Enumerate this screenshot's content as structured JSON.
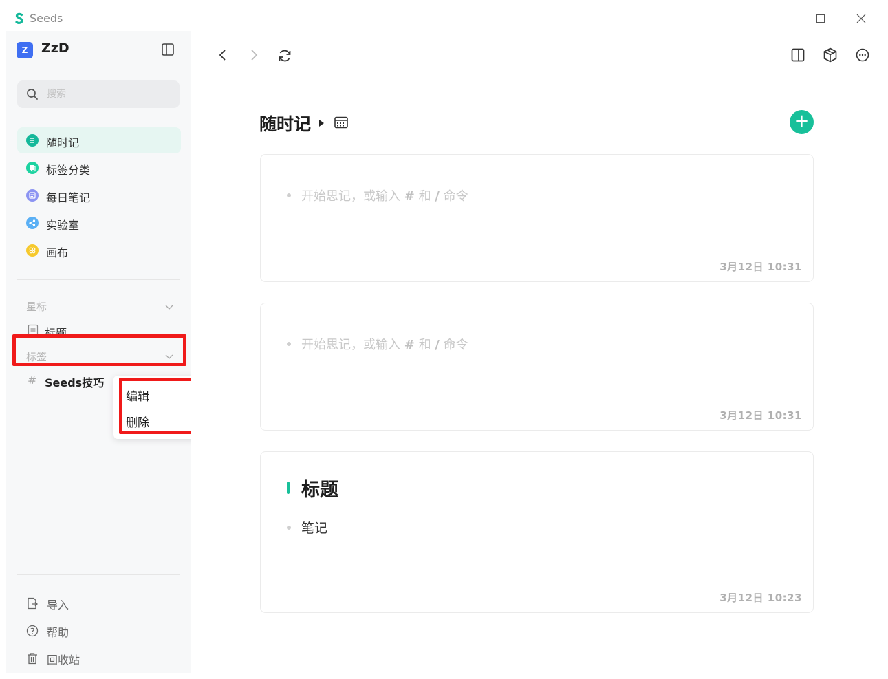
{
  "app": {
    "title": "Seeds"
  },
  "workspace": {
    "avatar_letter": "Z",
    "name": "ZzD"
  },
  "search": {
    "placeholder": "搜索"
  },
  "nav": [
    {
      "label": "随时记",
      "icon": "list-circle-icon",
      "color": "#14b89a",
      "active": true
    },
    {
      "label": "标签分类",
      "icon": "copy-circle-icon",
      "color": "#1dd3a1",
      "active": false
    },
    {
      "label": "每日笔记",
      "icon": "note-circle-icon",
      "color": "#8c94f2",
      "active": false
    },
    {
      "label": "实验室",
      "icon": "share-circle-icon",
      "color": "#5bb0f5",
      "active": false
    },
    {
      "label": "画布",
      "icon": "grid-circle-icon",
      "color": "#f6c92d",
      "active": false
    }
  ],
  "starred": {
    "title": "星标",
    "items": [
      {
        "label": "标题",
        "icon": "document-icon"
      }
    ]
  },
  "tags": {
    "title": "标签",
    "items": [
      {
        "prefix": "#",
        "label": "Seeds技巧"
      }
    ]
  },
  "context_menu": [
    {
      "label": "编辑",
      "icon": "edit-icon"
    },
    {
      "label": "删除",
      "icon": "trash-icon"
    }
  ],
  "bottom_nav": [
    {
      "label": "导入",
      "icon": "import-icon"
    },
    {
      "label": "帮助",
      "icon": "help-icon"
    },
    {
      "label": "回收站",
      "icon": "trash-icon"
    }
  ],
  "page": {
    "title": "随时记"
  },
  "cards": [
    {
      "placeholder_a": "开始思记，或输入",
      "hash": "#",
      "mid": "和",
      "slash": "/",
      "tail": "命令",
      "timestamp": "3月12日 10:31"
    },
    {
      "placeholder_a": "开始思记，或输入",
      "hash": "#",
      "mid": "和",
      "slash": "/",
      "tail": "命令",
      "timestamp": "3月12日 10:31"
    },
    {
      "heading": "标题",
      "text": "笔记",
      "timestamp": "3月12日 10:23"
    }
  ],
  "colors": {
    "accent": "#18c09a",
    "highlight": "#f01a1a"
  }
}
